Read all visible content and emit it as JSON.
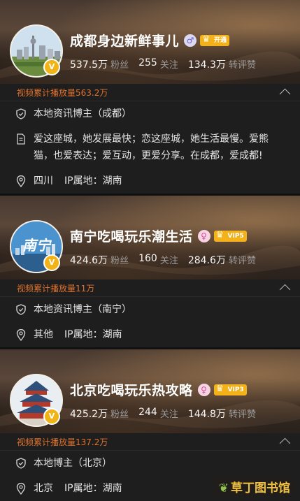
{
  "accounts": [
    {
      "name": "成都身边新鲜事儿",
      "gender_icon": "male-icon",
      "vip_label": "开通",
      "avatar_verified": "V",
      "fans": "537.5万",
      "fans_label": "粉丝",
      "follows": "255",
      "follows_label": "关注",
      "reposts": "134.3万",
      "reposts_label": "转评赞",
      "play_count": "视频累计播放量563.2万",
      "blogger_type": "本地资讯博主（成都）",
      "bio": "爱这座城，她发展最快；恋这座城，她生活最慢。爱熊猫，也爱表达；爱互动，更爱分享。在成都，爱成都!",
      "region": "四川",
      "ip": "IP属地：湖南"
    },
    {
      "name": "南宁吃喝玩乐潮生活",
      "gender_icon": "female-icon",
      "vip_label": "VIP5",
      "avatar_verified": "V",
      "avatar_text": "南宁",
      "fans": "424.6万",
      "fans_label": "粉丝",
      "follows": "160",
      "follows_label": "关注",
      "reposts": "284.6万",
      "reposts_label": "转评赞",
      "play_count": "视频累计播放量11万",
      "blogger_type": "本地资讯博主（南宁）",
      "region": "其他",
      "ip": "IP属地：湖南"
    },
    {
      "name": "北京吃喝玩乐热攻略",
      "gender_icon": "female-icon",
      "vip_label": "VIP3",
      "avatar_verified": "V",
      "fans": "425.2万",
      "fans_label": "粉丝",
      "follows": "244",
      "follows_label": "关注",
      "reposts": "144.8万",
      "reposts_label": "转评赞",
      "play_count": "视频累计播放量137.2万",
      "blogger_type": "本地博主（北京）",
      "region": "北京",
      "ip": "IP属地：湖南"
    }
  ],
  "watermark": "草丁图书馆",
  "colors": {
    "accent_orange": "#e2722b",
    "vip_gold": "#f3b21a",
    "background": "#1e1e1f"
  }
}
